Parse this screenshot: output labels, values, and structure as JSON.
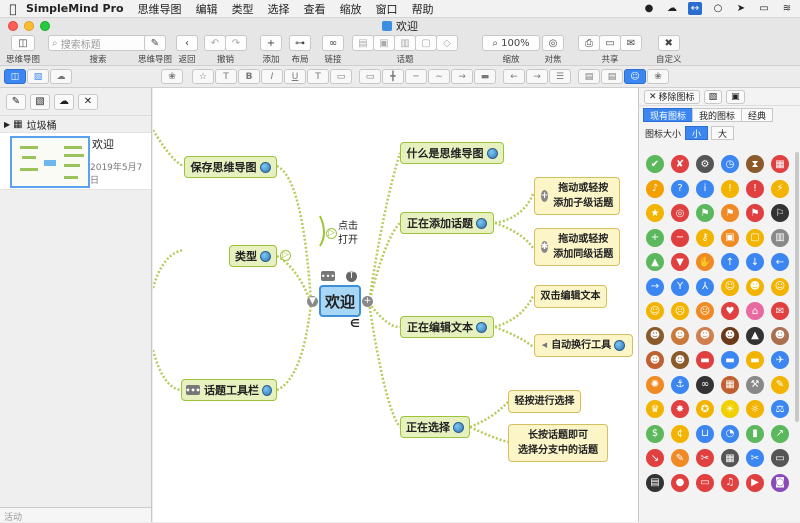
{
  "menubar": {
    "app_name": "SimpleMind Pro",
    "menus": [
      "思维导图",
      "编辑",
      "类型",
      "选择",
      "查看",
      "缩放",
      "窗口",
      "帮助"
    ]
  },
  "window": {
    "title": "欢迎"
  },
  "toolbar": {
    "mindmap_label": "思维导图",
    "search_placeholder": "搜索标题",
    "search_label": "搜索",
    "mindmap2_label": "思维导图",
    "back_label": "返回",
    "undo_label": "撤销",
    "add_label": "添加",
    "layout_label": "布局",
    "link_label": "链接",
    "topic_label": "话题",
    "zoom_value": "100%",
    "zoom_label": "缩放",
    "focus_label": "对焦",
    "share_label": "共享",
    "customize_label": "自定义"
  },
  "left_panel": {
    "trash_label": "垃圾桶",
    "doc_name": "欢迎",
    "doc_date": "2019年5月7日",
    "activity_label": "活动"
  },
  "mindmap": {
    "root": "欢迎",
    "left_topics": [
      "保存思维导图",
      "类型",
      "话题工具栏"
    ],
    "right_topics": [
      "什么是思维导图",
      "正在添加话题",
      "正在编辑文本",
      "正在选择"
    ],
    "click_open": [
      "点击",
      "打开"
    ],
    "add_child": [
      "拖动或轻按",
      "添加子级话题"
    ],
    "add_sibling": [
      "拖动或轻按",
      "添加同级话题"
    ],
    "double_click_edit": "双击编辑文本",
    "auto_wrap": "自动换行工具",
    "tap_select": "轻按进行选择",
    "long_press": [
      "长按话题即可",
      "选择分支中的话题"
    ]
  },
  "right_panel": {
    "remove_icon_label": "移除图标",
    "tabs": [
      "现有图标",
      "我的图标",
      "经典"
    ],
    "icon_size_label": "图标大小",
    "size_small": "小",
    "size_large": "大",
    "icons": [
      {
        "name": "check-icon",
        "glyph": "✔",
        "color": "#5cb85c"
      },
      {
        "name": "cross-icon",
        "glyph": "✘",
        "color": "#e04040"
      },
      {
        "name": "gear-icon",
        "glyph": "⚙",
        "color": "#555555"
      },
      {
        "name": "clock-icon",
        "glyph": "◷",
        "color": "#3b86f0"
      },
      {
        "name": "hourglass-icon",
        "glyph": "⧗",
        "color": "#8a5a2b"
      },
      {
        "name": "calendar-icon",
        "glyph": "▦",
        "color": "#e04040"
      },
      {
        "name": "bell-icon",
        "glyph": "♪",
        "color": "#f2a100"
      },
      {
        "name": "question-icon",
        "glyph": "?",
        "color": "#3b86f0"
      },
      {
        "name": "info-icon",
        "glyph": "i",
        "color": "#3b86f0"
      },
      {
        "name": "warning-icon",
        "glyph": "!",
        "color": "#f2b400"
      },
      {
        "name": "alert-icon",
        "glyph": "!",
        "color": "#e04040"
      },
      {
        "name": "lightning-icon",
        "glyph": "⚡",
        "color": "#f2b400"
      },
      {
        "name": "star-icon",
        "glyph": "★",
        "color": "#f2b400"
      },
      {
        "name": "target-icon",
        "glyph": "◎",
        "color": "#e04040"
      },
      {
        "name": "flag-green-icon",
        "glyph": "⚑",
        "color": "#5cb85c"
      },
      {
        "name": "flag-orange-icon",
        "glyph": "⚑",
        "color": "#f08a24"
      },
      {
        "name": "flag-red-icon",
        "glyph": "⚑",
        "color": "#e04040"
      },
      {
        "name": "flag-checkered-icon",
        "glyph": "⚐",
        "color": "#333333"
      },
      {
        "name": "plus-icon",
        "glyph": "+",
        "color": "#5cb85c"
      },
      {
        "name": "minus-icon",
        "glyph": "−",
        "color": "#e04040"
      },
      {
        "name": "key-icon",
        "glyph": "⚷",
        "color": "#f2b400"
      },
      {
        "name": "lock-icon",
        "glyph": "▣",
        "color": "#f08a24"
      },
      {
        "name": "unlock-icon",
        "glyph": "▢",
        "color": "#f2b400"
      },
      {
        "name": "trash-icon",
        "glyph": "▥",
        "color": "#888888"
      },
      {
        "name": "thumbs-up-icon",
        "glyph": "▲",
        "color": "#5cb85c"
      },
      {
        "name": "thumbs-down-icon",
        "glyph": "▼",
        "color": "#e04040"
      },
      {
        "name": "handshake-icon",
        "glyph": "✋",
        "color": "#f08a24"
      },
      {
        "name": "arrow-up-icon",
        "glyph": "↑",
        "color": "#3b86f0"
      },
      {
        "name": "arrow-down-icon",
        "glyph": "↓",
        "color": "#3b86f0"
      },
      {
        "name": "arrow-left-icon",
        "glyph": "←",
        "color": "#3b86f0"
      },
      {
        "name": "arrow-right-icon",
        "glyph": "→",
        "color": "#3b86f0"
      },
      {
        "name": "fork-icon",
        "glyph": "Y",
        "color": "#3b86f0"
      },
      {
        "name": "merge-icon",
        "glyph": "⅄",
        "color": "#3b86f0"
      },
      {
        "name": "smile-icon",
        "glyph": "☺",
        "color": "#f2b400"
      },
      {
        "name": "grin-icon",
        "glyph": "☻",
        "color": "#f2b400"
      },
      {
        "name": "wink-icon",
        "glyph": "☺",
        "color": "#f2b400"
      },
      {
        "name": "neutral-icon",
        "glyph": "☺",
        "color": "#f2b400"
      },
      {
        "name": "frown-icon",
        "glyph": "☹",
        "color": "#f2b400"
      },
      {
        "name": "angry-icon",
        "glyph": "☹",
        "color": "#f08a24"
      },
      {
        "name": "heart-icon",
        "glyph": "♥",
        "color": "#e04040"
      },
      {
        "name": "cake-icon",
        "glyph": "⌂",
        "color": "#e86aa0"
      },
      {
        "name": "gift-icon",
        "glyph": "✉",
        "color": "#e04040"
      },
      {
        "name": "person-icon",
        "glyph": "☻",
        "color": "#8a5a2b"
      },
      {
        "name": "person2-icon",
        "glyph": "☻",
        "color": "#c87a3a"
      },
      {
        "name": "person3-icon",
        "glyph": "☻",
        "color": "#d08050"
      },
      {
        "name": "person4-icon",
        "glyph": "☻",
        "color": "#6a3a1a"
      },
      {
        "name": "graduate-icon",
        "glyph": "▲",
        "color": "#333333"
      },
      {
        "name": "user-icon",
        "glyph": "☻",
        "color": "#aa7050"
      },
      {
        "name": "worker-icon",
        "glyph": "☻",
        "color": "#c06030"
      },
      {
        "name": "man-icon",
        "glyph": "☻",
        "color": "#8a5a2b"
      },
      {
        "name": "car-icon",
        "glyph": "▬",
        "color": "#e04040"
      },
      {
        "name": "truck-icon",
        "glyph": "▬",
        "color": "#3b86f0"
      },
      {
        "name": "bus-icon",
        "glyph": "▬",
        "color": "#f2b400"
      },
      {
        "name": "plane-icon",
        "glyph": "✈",
        "color": "#3b86f0"
      },
      {
        "name": "wheel-icon",
        "glyph": "✺",
        "color": "#f08a24"
      },
      {
        "name": "anchor-icon",
        "glyph": "⚓",
        "color": "#3b86f0"
      },
      {
        "name": "binoculars-icon",
        "glyph": "∞",
        "color": "#333333"
      },
      {
        "name": "wall-icon",
        "glyph": "▦",
        "color": "#c06030"
      },
      {
        "name": "hammer-icon",
        "glyph": "⚒",
        "color": "#888888"
      },
      {
        "name": "pencil-icon",
        "glyph": "✎",
        "color": "#f2b400"
      },
      {
        "name": "crown-icon",
        "glyph": "♛",
        "color": "#f2b400"
      },
      {
        "name": "burst-icon",
        "glyph": "✸",
        "color": "#e04040"
      },
      {
        "name": "medal-icon",
        "glyph": "✪",
        "color": "#f2b400"
      },
      {
        "name": "lightbulb-icon",
        "glyph": "☀",
        "color": "#f2d000"
      },
      {
        "name": "bulb-outline-icon",
        "glyph": "☼",
        "color": "#f2b400"
      },
      {
        "name": "scale-icon",
        "glyph": "⚖",
        "color": "#3b86f0"
      },
      {
        "name": "money-icon",
        "glyph": "$",
        "color": "#5cb85c"
      },
      {
        "name": "coins-icon",
        "glyph": "¢",
        "color": "#f2b400"
      },
      {
        "name": "cart-icon",
        "glyph": "⊔",
        "color": "#3b86f0"
      },
      {
        "name": "pie-icon",
        "glyph": "◔",
        "color": "#3b86f0"
      },
      {
        "name": "bar-chart-icon",
        "glyph": "▮",
        "color": "#5cb85c"
      },
      {
        "name": "line-chart-icon",
        "glyph": "↗",
        "color": "#5cb85c"
      },
      {
        "name": "trend-down-icon",
        "glyph": "↘",
        "color": "#e04040"
      },
      {
        "name": "pencil2-icon",
        "glyph": "✎",
        "color": "#f08a24"
      },
      {
        "name": "tools-icon",
        "glyph": "✂",
        "color": "#e04040"
      },
      {
        "name": "calculator-icon",
        "glyph": "▦",
        "color": "#555555"
      },
      {
        "name": "scissors-icon",
        "glyph": "✂",
        "color": "#3b86f0"
      },
      {
        "name": "monitor-icon",
        "glyph": "▭",
        "color": "#555555"
      },
      {
        "name": "film-icon",
        "glyph": "▤",
        "color": "#333333"
      },
      {
        "name": "pin-icon",
        "glyph": "●",
        "color": "#e04040"
      },
      {
        "name": "folder-icon",
        "glyph": "▭",
        "color": "#e04040"
      },
      {
        "name": "music-icon",
        "glyph": "♫",
        "color": "#e04040"
      },
      {
        "name": "media-icon",
        "glyph": "▶",
        "color": "#e04040"
      },
      {
        "name": "camera-icon",
        "glyph": "◙",
        "color": "#8a4ab8"
      }
    ]
  }
}
